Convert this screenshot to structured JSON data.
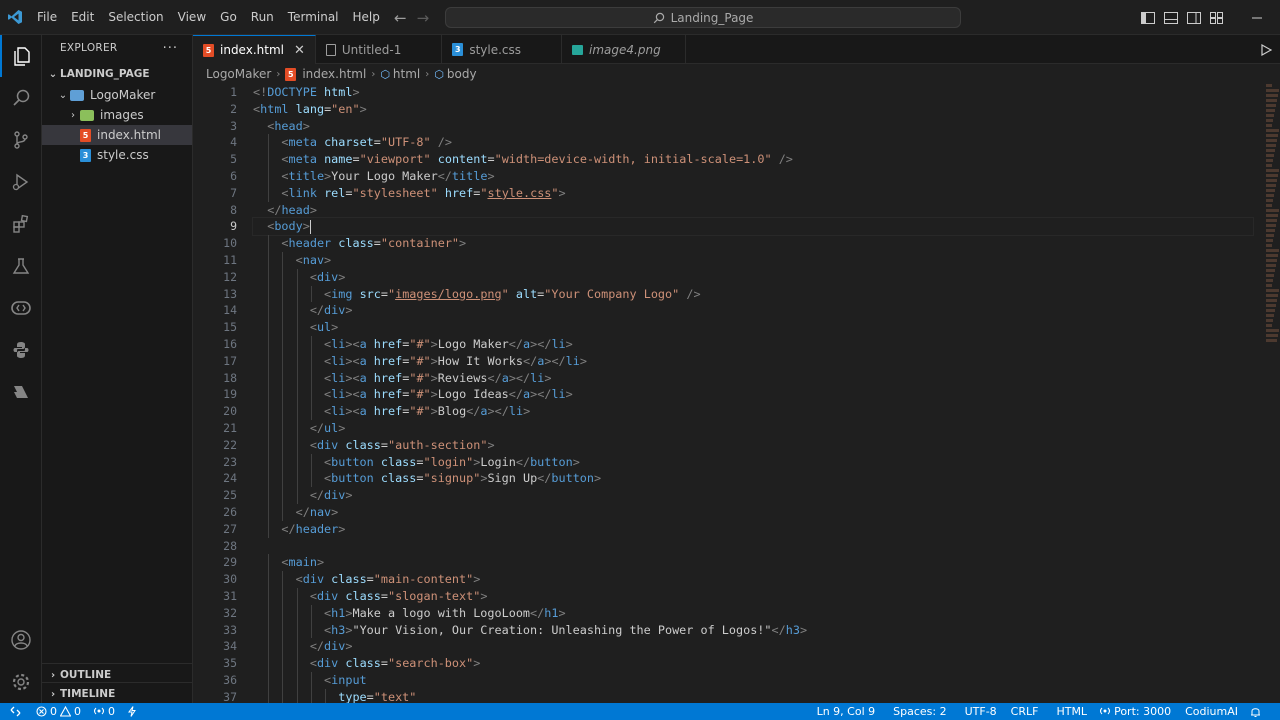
{
  "titlebar": {
    "menu": [
      "File",
      "Edit",
      "Selection",
      "View",
      "Go",
      "Run",
      "Terminal",
      "Help"
    ],
    "search_text": "Landing_Page"
  },
  "sidebar": {
    "header": "EXPLORER",
    "more": "···",
    "root": "LANDING_PAGE",
    "folder": "LogoMaker",
    "items": [
      "images",
      "index.html",
      "style.css"
    ],
    "outline": "OUTLINE",
    "timeline": "TIMELINE"
  },
  "tabs": [
    {
      "label": "index.html"
    },
    {
      "label": "Untitled-1"
    },
    {
      "label": "style.css"
    },
    {
      "label": "image4.png"
    }
  ],
  "breadcrumb": [
    "LogoMaker",
    "index.html",
    "html",
    "body"
  ],
  "code_lines": [
    "<!DOCTYPE html>",
    "<html lang=\"en\">",
    "  <head>",
    "    <meta charset=\"UTF-8\" />",
    "    <meta name=\"viewport\" content=\"width=device-width, initial-scale=1.0\" />",
    "    <title>Your Logo Maker</title>",
    "    <link rel=\"stylesheet\" href=\"style.css\">",
    "  </head>",
    "  <body>",
    "    <header class=\"container\">",
    "      <nav>",
    "        <div>",
    "          <img src=\"images/logo.png\" alt=\"Your Company Logo\" />",
    "        </div>",
    "        <ul>",
    "          <li><a href=\"#\">Logo Maker</a></li>",
    "          <li><a href=\"#\">How It Works</a></li>",
    "          <li><a href=\"#\">Reviews</a></li>",
    "          <li><a href=\"#\">Logo Ideas</a></li>",
    "          <li><a href=\"#\">Blog</a></li>",
    "        </ul>",
    "        <div class=\"auth-section\">",
    "          <button class=\"login\">Login</button>",
    "          <button class=\"signup\">Sign Up</button>",
    "        </div>",
    "      </nav>",
    "    </header>",
    "",
    "    <main>",
    "      <div class=\"main-content\">",
    "        <div class=\"slogan-text\">",
    "          <h1>Make a logo with LogoLoom</h1>",
    "          <h3>\"Your Vision, Our Creation: Unleashing the Power of Logos!\"</h3>",
    "        </div>",
    "        <div class=\"search-box\">",
    "          <input",
    "            type=\"text\""
  ],
  "current_line": 9,
  "statusbar": {
    "errors": "0",
    "warnings": "0",
    "ports": "0",
    "position": "Ln 9, Col 9",
    "spaces": "Spaces: 2",
    "encoding": "UTF-8",
    "eol": "CRLF",
    "language": "HTML",
    "port": "Port: 3000",
    "ai": "CodiumAI"
  },
  "icons": {
    "activity": [
      "files-icon",
      "search-icon",
      "source-control-icon",
      "run-debug-icon",
      "extensions-icon",
      "testing-icon",
      "remote-explorer-icon",
      "python-icon",
      "deploy-icon",
      "account-icon",
      "settings-gear-icon"
    ]
  },
  "colors": {
    "accent": "#0078d4",
    "tag": "#569cd6",
    "attr": "#9cdcfe",
    "string": "#ce9178"
  }
}
